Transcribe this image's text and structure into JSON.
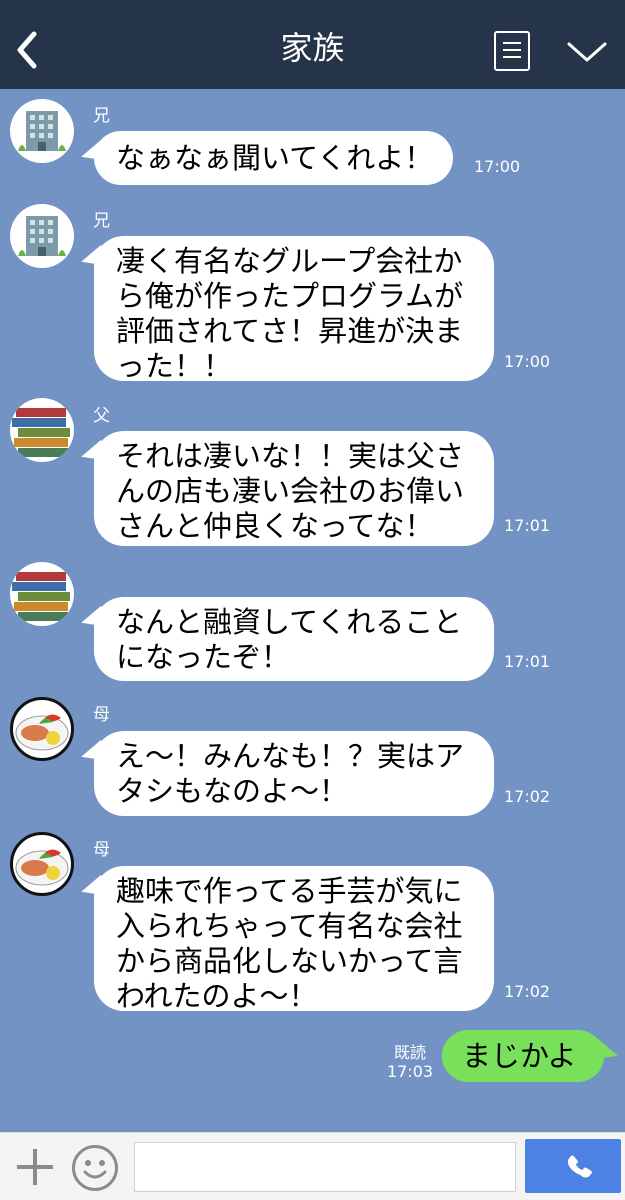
{
  "header": {
    "title": "家族"
  },
  "messages": [
    {
      "sender": "兄",
      "text": "なぁなぁ聞いてくれよ！",
      "time": "17:00",
      "avatar_icon": "building-icon"
    },
    {
      "sender": "兄",
      "text": "凄く有名なグループ会社か\nら俺が作ったプログラムが\n評価されてさ！昇進が決ま\nった！！",
      "time": "17:00",
      "avatar_icon": "building-icon"
    },
    {
      "sender": "父",
      "text": "それは凄いな！！実は父さ\nんの店も凄い会社のお偉い\nさんと仲良くなってな！",
      "time": "17:01",
      "avatar_icon": "books-icon"
    },
    {
      "sender": "",
      "text": "なんと融資してくれること\nになったぞ！",
      "time": "17:01",
      "avatar_icon": "books-icon"
    },
    {
      "sender": "母",
      "text": "え〜！みんなも！？実はア\nタシもなのよ〜！",
      "time": "17:02",
      "avatar_icon": "food-plate-icon"
    },
    {
      "sender": "母",
      "text": "趣味で作ってる手芸が気に\n入られちゃって有名な会社\nから商品化しないかって言\nわれたのよ〜！",
      "time": "17:02",
      "avatar_icon": "food-plate-icon"
    }
  ],
  "my_message": {
    "text": "まじかよ",
    "read_label": "既読",
    "time": "17:03"
  },
  "input": {
    "placeholder": ""
  },
  "colors": {
    "background": "#7393c4",
    "header": "#253449",
    "my_bubble": "#78e05a",
    "call_button": "#4b82e3"
  },
  "icons": [
    "back-arrow-icon",
    "menu-list-icon",
    "chevron-down-icon",
    "plus-icon",
    "emoji-icon",
    "phone-icon"
  ]
}
